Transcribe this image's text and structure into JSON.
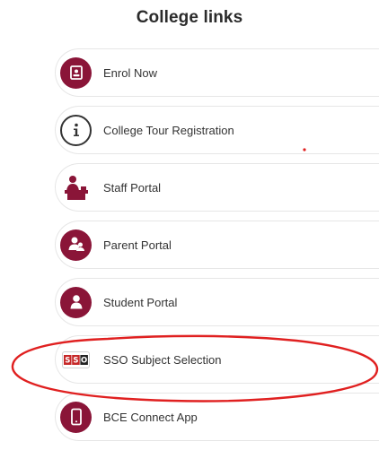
{
  "page": {
    "title": "College links"
  },
  "links": [
    {
      "label": "Enrol Now",
      "icon": "form-icon"
    },
    {
      "label": "College Tour Registration",
      "icon": "info-icon"
    },
    {
      "label": "Staff Portal",
      "icon": "teacher-desk-icon"
    },
    {
      "label": "Parent Portal",
      "icon": "parent-child-icon"
    },
    {
      "label": "Student Portal",
      "icon": "student-person-icon"
    },
    {
      "label": "SSO Subject Selection",
      "icon": "sso-logo-icon",
      "logo_text": "SSO"
    },
    {
      "label": "BCE Connect App",
      "icon": "mobile-phone-icon"
    }
  ],
  "colors": {
    "accent": "#8a1538",
    "annotation": "#e02020"
  }
}
